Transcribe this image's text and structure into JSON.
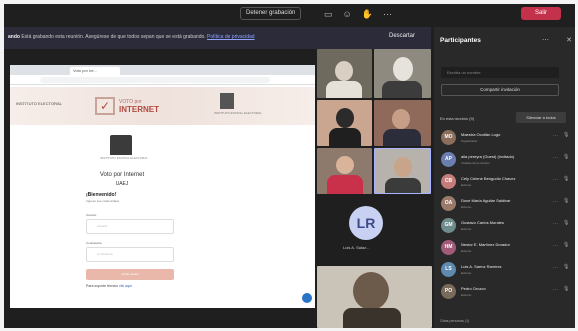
{
  "topbar": {
    "stop_recording_label": "Detener grabación",
    "leave_label": "Salir",
    "icons": [
      "chat-icon",
      "reactions-icon",
      "raise-hand-icon",
      "more-icon"
    ]
  },
  "recording_banner": {
    "bold": "ando",
    "message": "Está grabando esta reunión. Asegúrese de que todos sepan que se está grabando.",
    "link": "Política de privacidad",
    "dismiss": "Descartar"
  },
  "shared_screen": {
    "browser_tab": "Voto por Int...",
    "site_left_logo": "INSTITUTO ELECTORAL",
    "site_logo_pre": "VOTO por",
    "site_logo_main": "INTERNET",
    "site_right_caption": "INSTITUTO ESTATAL ELECTORAL",
    "seal_caption": "INSTITUTO ESTATAL ELECTORAL",
    "title": "Voto por Internet",
    "org": "UAEJ",
    "welcome": "¡Bienvenido!",
    "welcome_sub": "Ingrese sus credenciales",
    "user_label": "Usuario",
    "user_placeholder": "Usuario",
    "pass_label": "Contraseña",
    "pass_placeholder": "Contraseña",
    "login_button": "Iniciar sesión",
    "support_text": "Para soporte técnico",
    "support_link": "clic aquí"
  },
  "gallery": {
    "avatar_initials": "LR",
    "avatar_name": "Luis A. Salaz..."
  },
  "participants": {
    "title": "Participantes",
    "search_placeholder": "Escriba un nombre",
    "share_invite": "Compartir invitación",
    "in_meeting": "En esta reunión (9)",
    "mute_all": "Silenciar a todos",
    "more_hint": "Otras personas (1)",
    "list": [
      {
        "initials": "MO",
        "name": "Maestra Ocotlán Lugo",
        "role": "Organizador",
        "color": "#8a6d5a"
      },
      {
        "initials": "AP",
        "name": "alla pereyra (Guest) (Invitado)",
        "role": "Invitado de la reunión",
        "color": "#6a7fb0"
      },
      {
        "initials": "CB",
        "name": "Cely Celene Bengudio Chavez",
        "role": "Externo",
        "color": "#c77c7c"
      },
      {
        "initials": "OA",
        "name": "Doce María Aguilar Saldivar",
        "role": "Externo",
        "color": "#9a7a6a"
      },
      {
        "initials": "GM",
        "name": "Gustavo Carlos Morales",
        "role": "Externo",
        "color": "#6f8c8c"
      },
      {
        "initials": "HM",
        "name": "Nestor E. Martínez Dorador",
        "role": "Externo",
        "color": "#a05a7a"
      },
      {
        "initials": "LS",
        "name": "Luis A. Saenz Ramírez",
        "role": "Externo",
        "color": "#5f8ab0"
      },
      {
        "initials": "PO",
        "name": "Pedro Orozco",
        "role": "Externo",
        "color": "#7a6a5a"
      }
    ]
  },
  "colors": {
    "teams_bg": "#1f1f1f",
    "panel_bg": "#292929",
    "leave_red": "#c4314b",
    "brand_accent": "#b24a3f"
  }
}
